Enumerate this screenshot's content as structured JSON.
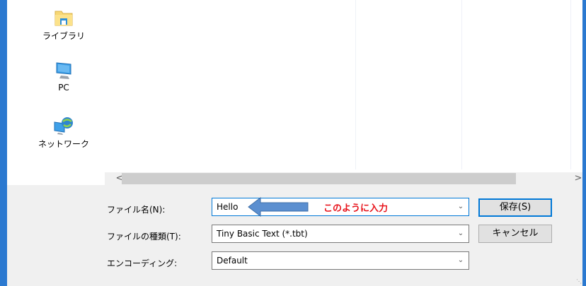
{
  "nav": {
    "items": [
      {
        "label": "ライブラリ",
        "icon": "library-folder-icon"
      },
      {
        "label": "PC",
        "icon": "computer-monitor-icon"
      },
      {
        "label": "ネットワーク",
        "icon": "network-globe-icon"
      }
    ]
  },
  "scrollbar": {
    "left_arrow": "<",
    "right_arrow": ">"
  },
  "form": {
    "filename_label": "ファイル名(N):",
    "filename_value": "Hello",
    "filetype_label": "ファイルの種類(T):",
    "filetype_value": "Tiny Basic Text (*.tbt)",
    "encoding_label": "エンコーディング:",
    "encoding_value": "Default"
  },
  "buttons": {
    "save_label": "保存(S)",
    "cancel_label": "キャンセル"
  },
  "annotation": {
    "text": "このように入力",
    "color": "#e8121a",
    "arrow_color": "#5b8fd0"
  },
  "colors": {
    "accent": "#0078d7",
    "window_border": "#2b79d0"
  }
}
